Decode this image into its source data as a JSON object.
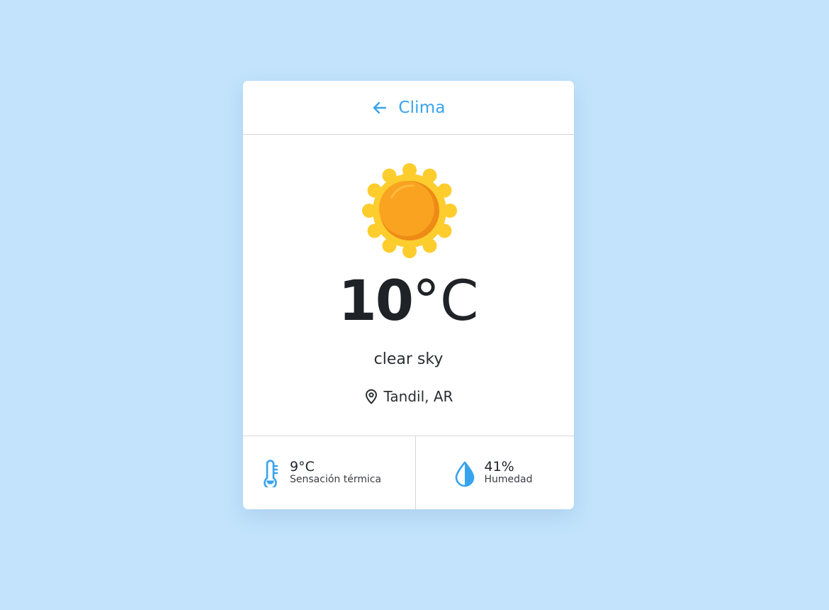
{
  "header": {
    "title": "Clima"
  },
  "weather": {
    "icon": "sun-icon",
    "temperature": "10",
    "unit": "°C",
    "description": "clear sky",
    "location": "Tandil, AR"
  },
  "stats": {
    "feels_like": {
      "value": "9°C",
      "label": "Sensación térmica",
      "icon": "thermometer-icon"
    },
    "humidity": {
      "value": "41%",
      "label": "Humedad",
      "icon": "water-drop-icon"
    }
  },
  "colors": {
    "background": "#c2e3fb",
    "accent": "#37a3ee",
    "card": "#ffffff",
    "sun_rays": "#fdcd2e",
    "sun_core": "#f9a321",
    "text": "#1f2328"
  }
}
